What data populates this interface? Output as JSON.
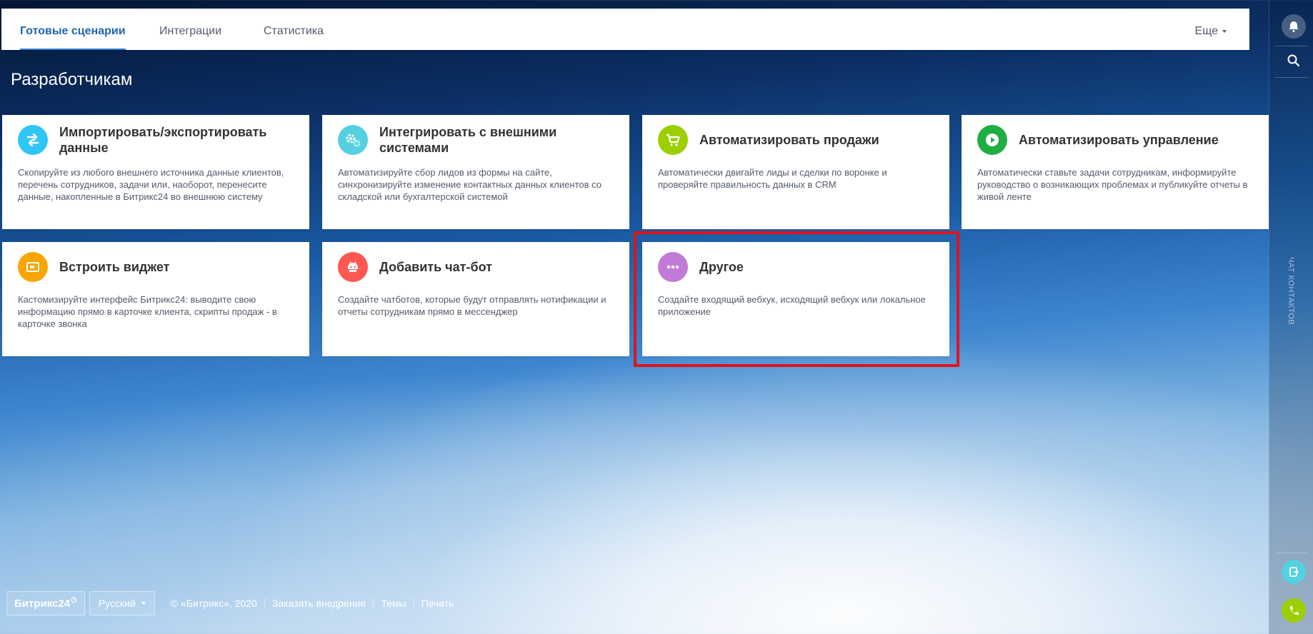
{
  "nav": {
    "tabs": [
      {
        "label": "Готовые сценарии",
        "active": true
      },
      {
        "label": "Интеграции",
        "active": false
      },
      {
        "label": "Статистика",
        "active": false
      }
    ],
    "more_label": "Еще"
  },
  "page": {
    "title": "Разработчикам"
  },
  "cards": [
    {
      "title": "Импортировать/экспортировать данные",
      "description": "Скопируйте из любого внешнего источника данные клиентов, перечень сотрудников, задачи или, наоборот, перенесите данные, накопленные в Битрикс24 во внешнюю систему",
      "icon": "arrows-exchange-icon",
      "color": "#2fc6f6"
    },
    {
      "title": "Интегрировать с внешними системами",
      "description": "Автоматизируйте сбор лидов из формы на сайте, синхронизируйте изменение контактных данных клиентов со складской или бухгалтерской системой",
      "icon": "gears-icon",
      "color": "#55d0e0"
    },
    {
      "title": "Автоматизировать продажи",
      "description": "Автоматически двигайте лиды и сделки по воронке и проверяйте правильность данных в CRM",
      "icon": "cart-icon",
      "color": "#9dcf00"
    },
    {
      "title": "Автоматизировать управление",
      "description": "Автоматически ставьте задачи сотрудникам, информируйте руководство о возникающих проблемах и публикуйте отчеты в живой ленте",
      "icon": "play-icon",
      "color": "#1eae43"
    },
    {
      "title": "Встроить виджет",
      "description": "Кастомизируйте интерфейс Битрикс24: выводите свою информацию прямо в карточке клиента, скрипты продаж - в карточке звонка",
      "icon": "widget-icon",
      "color": "#f7a700"
    },
    {
      "title": "Добавить чат-бот",
      "description": "Создайте чатботов, которые будут отправлять нотификации и отчеты сотрудникам прямо в мессенджер",
      "icon": "robot-icon",
      "color": "#ff5752"
    },
    {
      "title": "Другое",
      "description": "Создайте входящий вебхук, исходящий вебхук или локальное приложение",
      "icon": "more-dots-icon",
      "color": "#c27ad8"
    }
  ],
  "sidebar": {
    "vertical_label": "ЧАТ КОНТАКТОВ"
  },
  "footer": {
    "logo": "Битрикс24",
    "language": "Русский",
    "copyright": "© «Битрикс», 2020",
    "links": [
      "Заказать внедрение",
      "Темы",
      "Печать"
    ]
  },
  "colors": {
    "accent": "#2067b0",
    "highlight": "#e0121c"
  }
}
